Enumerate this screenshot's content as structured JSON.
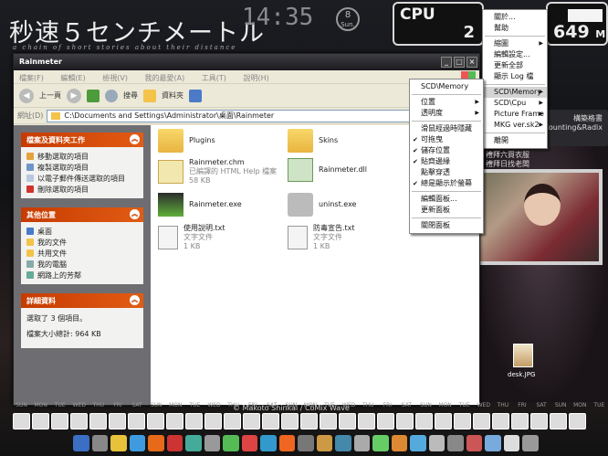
{
  "desktop": {
    "title_jp": "秒速５センチメートル",
    "subtitle": "a chain of short stories about their distance",
    "clock": "14:35",
    "day_num": "8",
    "day_name": "Sun.",
    "cpu_label": "CPU",
    "cpu_value": "2",
    "mem_value": "649",
    "mem_unit": "M",
    "side_card_text": "構築格書",
    "side_card_text2": "Counting&Radix",
    "side_links": [
      "禮拜六買衣服",
      "禮拜日找老闆"
    ],
    "desk_file_label": "desk.JPG",
    "credit": "© Makoto Shinkai / CoMix Wave",
    "calendar_days": [
      "SUN",
      "MON",
      "TUE",
      "WED",
      "THU",
      "FRI",
      "SAT",
      "SUN",
      "MON",
      "TUE",
      "WED",
      "THU",
      "FRI",
      "SAT",
      "SUN",
      "MON",
      "TUE",
      "WED",
      "THU",
      "FRI",
      "SAT",
      "SUN",
      "MON",
      "TUE",
      "WED",
      "THU",
      "FRI",
      "SAT",
      "SUN",
      "MON",
      "TUE"
    ]
  },
  "window": {
    "title": "Rainmeter",
    "menu": [
      "檔案(F)",
      "編輯(E)",
      "檢視(V)",
      "我的最愛(A)",
      "工具(T)",
      "說明(H)"
    ],
    "toolbar": {
      "back": "上一頁",
      "search": "搜尋",
      "folders": "資料夾"
    },
    "address_label": "網址(D)",
    "address_value": "C:\\Documents and Settings\\Administrator\\桌面\\Rainmeter",
    "tasks_header": "檔案及資料夾工作",
    "tasks": [
      "移動選取的項目",
      "複製選取的項目",
      "以電子郵件傳送選取的項目",
      "刪除選取的項目"
    ],
    "places_header": "其他位置",
    "places": [
      "桌面",
      "我的文件",
      "共用文件",
      "我的電腦",
      "網路上的芳鄰"
    ],
    "details_header": "詳細資料",
    "details_line1": "選取了 3 個項目。",
    "details_line2": "檔案大小總計: 964 KB",
    "files": [
      {
        "name": "Plugins",
        "sub1": "",
        "sub2": ""
      },
      {
        "name": "Skins",
        "sub1": "",
        "sub2": ""
      },
      {
        "name": "Rainmeter.chm",
        "sub1": "已編譯的 HTML Help 檔案",
        "sub2": "58 KB"
      },
      {
        "name": "Rainmeter.dll",
        "sub1": "",
        "sub2": ""
      },
      {
        "name": "Rainmeter.exe",
        "sub1": "",
        "sub2": ""
      },
      {
        "name": "uninst.exe",
        "sub1": "",
        "sub2": ""
      },
      {
        "name": "使用說明.txt",
        "sub1": "文字文件",
        "sub2": "1 KB"
      },
      {
        "name": "防毒宣告.txt",
        "sub1": "文字文件",
        "sub2": "1 KB"
      }
    ]
  },
  "menu_main": {
    "items": [
      "關於...",
      "幫助",
      "",
      "縮圖",
      "編輯設定...",
      "更新全部",
      "顯示 Log 檔",
      "",
      "SCD\\Memory",
      "SCD\\Cpu",
      "Picture Frame",
      "MKG ver.sk2",
      "",
      "離開"
    ]
  },
  "menu_skin": {
    "header": "SCD\\Memory",
    "items": [
      "位置",
      "透明度",
      "",
      "滑鼠經過時隱藏",
      "可拖曳",
      "儲存位置",
      "貼齊邊緣",
      "點擊穿透",
      "總是顯示於螢幕",
      "",
      "編輯面板...",
      "更新面板",
      "",
      "關閉面板"
    ],
    "checked": [
      false,
      false,
      false,
      false,
      true,
      true,
      true,
      false,
      true,
      false,
      false,
      false,
      false,
      false
    ]
  }
}
